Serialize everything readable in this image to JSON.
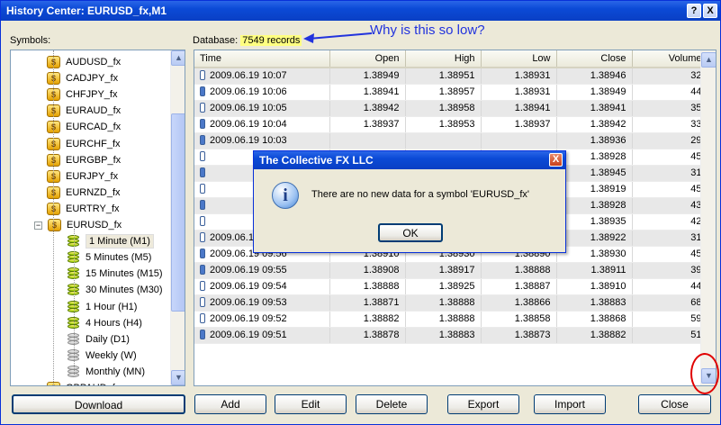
{
  "window": {
    "title": "History Center: EURUSD_fx,M1",
    "help_label": "?",
    "close_label": "X"
  },
  "symbols_label": "Symbols:",
  "database": {
    "label": "Database:",
    "value": "7549 records"
  },
  "annotation": "Why is this so low?",
  "tree": [
    {
      "label": "AUDUSD_fx",
      "icon": "coin-icon",
      "level": 1
    },
    {
      "label": "CADJPY_fx",
      "icon": "coin-icon",
      "level": 1
    },
    {
      "label": "CHFJPY_fx",
      "icon": "coin-icon",
      "level": 1
    },
    {
      "label": "EURAUD_fx",
      "icon": "coin-icon",
      "level": 1
    },
    {
      "label": "EURCAD_fx",
      "icon": "coin-icon",
      "level": 1
    },
    {
      "label": "EURCHF_fx",
      "icon": "coin-icon",
      "level": 1
    },
    {
      "label": "EURGBP_fx",
      "icon": "coin-icon",
      "level": 1
    },
    {
      "label": "EURJPY_fx",
      "icon": "coin-icon",
      "level": 1
    },
    {
      "label": "EURNZD_fx",
      "icon": "coin-icon",
      "level": 1
    },
    {
      "label": "EURTRY_fx",
      "icon": "coin-icon",
      "level": 1
    },
    {
      "label": "EURUSD_fx",
      "icon": "coin-icon",
      "level": 1,
      "expanded": true
    },
    {
      "label": "1 Minute (M1)",
      "icon": "db-color-icon",
      "level": 2,
      "selected": true
    },
    {
      "label": "5 Minutes (M5)",
      "icon": "db-color-icon",
      "level": 2
    },
    {
      "label": "15 Minutes (M15)",
      "icon": "db-color-icon",
      "level": 2
    },
    {
      "label": "30 Minutes (M30)",
      "icon": "db-color-icon",
      "level": 2
    },
    {
      "label": "1 Hour (H1)",
      "icon": "db-color-icon",
      "level": 2
    },
    {
      "label": "4 Hours (H4)",
      "icon": "db-color-icon",
      "level": 2
    },
    {
      "label": "Daily (D1)",
      "icon": "db-gray-icon",
      "level": 2
    },
    {
      "label": "Weekly (W)",
      "icon": "db-gray-icon",
      "level": 2
    },
    {
      "label": "Monthly (MN)",
      "icon": "db-gray-icon",
      "level": 2
    },
    {
      "label": "GBPAUD_fx",
      "icon": "coin-icon",
      "level": 1
    }
  ],
  "coin_glyph": "$",
  "expander_glyph": "−",
  "columns": [
    "Time",
    "Open",
    "High",
    "Low",
    "Close",
    "Volume"
  ],
  "rows": [
    {
      "time": "2009.06.19 10:07",
      "open": "1.38949",
      "high": "1.38951",
      "low": "1.38931",
      "close": "1.38946",
      "volume": "32",
      "bull": false
    },
    {
      "time": "2009.06.19 10:06",
      "open": "1.38941",
      "high": "1.38957",
      "low": "1.38931",
      "close": "1.38949",
      "volume": "44",
      "bull": true
    },
    {
      "time": "2009.06.19 10:05",
      "open": "1.38942",
      "high": "1.38958",
      "low": "1.38941",
      "close": "1.38941",
      "volume": "35",
      "bull": false
    },
    {
      "time": "2009.06.19 10:04",
      "open": "1.38937",
      "high": "1.38953",
      "low": "1.38937",
      "close": "1.38942",
      "volume": "33",
      "bull": true
    },
    {
      "time": "2009.06.19 10:03",
      "open": "",
      "high": "",
      "low": "",
      "close": "1.38936",
      "volume": "29",
      "bull": true
    },
    {
      "time": "",
      "open": "",
      "high": "",
      "low": "",
      "close": "1.38928",
      "volume": "45",
      "bull": false
    },
    {
      "time": "",
      "open": "",
      "high": "",
      "low": "",
      "close": "1.38945",
      "volume": "31",
      "bull": true
    },
    {
      "time": "",
      "open": "",
      "high": "",
      "low": "",
      "close": "1.38919",
      "volume": "45",
      "bull": false
    },
    {
      "time": "",
      "open": "",
      "high": "",
      "low": "",
      "close": "1.38928",
      "volume": "43",
      "bull": true
    },
    {
      "time": "",
      "open": "",
      "high": "",
      "low": "",
      "close": "1.38935",
      "volume": "42",
      "bull": false
    },
    {
      "time": "2009.06.19 09:57",
      "open": "1.38929",
      "high": "1.38940",
      "low": "1.38922",
      "close": "1.38922",
      "volume": "31",
      "bull": false
    },
    {
      "time": "2009.06.19 09:56",
      "open": "1.38910",
      "high": "1.38930",
      "low": "1.38890",
      "close": "1.38930",
      "volume": "45",
      "bull": true
    },
    {
      "time": "2009.06.19 09:55",
      "open": "1.38908",
      "high": "1.38917",
      "low": "1.38888",
      "close": "1.38911",
      "volume": "39",
      "bull": true
    },
    {
      "time": "2009.06.19 09:54",
      "open": "1.38888",
      "high": "1.38925",
      "low": "1.38887",
      "close": "1.38910",
      "volume": "44",
      "bull": false
    },
    {
      "time": "2009.06.19 09:53",
      "open": "1.38871",
      "high": "1.38888",
      "low": "1.38866",
      "close": "1.38883",
      "volume": "68",
      "bull": false
    },
    {
      "time": "2009.06.19 09:52",
      "open": "1.38882",
      "high": "1.38888",
      "low": "1.38858",
      "close": "1.38868",
      "volume": "59",
      "bull": false
    },
    {
      "time": "2009.06.19 09:51",
      "open": "1.38878",
      "high": "1.38883",
      "low": "1.38873",
      "close": "1.38882",
      "volume": "51",
      "bull": true
    }
  ],
  "buttons": {
    "download": "Download",
    "add": "Add",
    "edit": "Edit",
    "delete": "Delete",
    "export": "Export",
    "import": "Import",
    "close": "Close"
  },
  "dialog": {
    "title": "The Collective FX LLC",
    "message": "There are no new data for a symbol 'EURUSD_fx'",
    "ok": "OK",
    "close": "X",
    "icon_glyph": "i"
  },
  "scroll": {
    "up": "▲",
    "down": "▼"
  }
}
